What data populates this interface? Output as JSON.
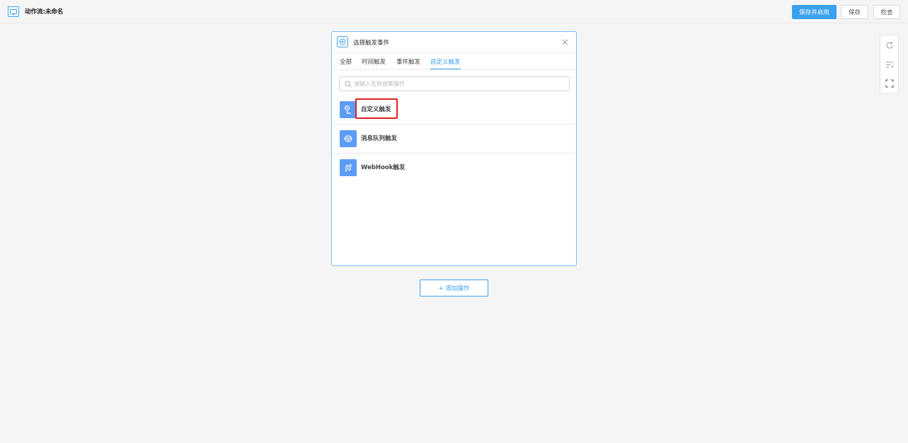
{
  "header": {
    "title": "动作流:未命名",
    "primary_button": "保存并启用",
    "save_button": "保存",
    "check_button": "检查"
  },
  "toolbar": {
    "tools": [
      "refresh-icon",
      "sort-icon",
      "fit-view-icon"
    ]
  },
  "dialog": {
    "title": "选择触发事件",
    "tabs": [
      {
        "label": "全部",
        "active": false
      },
      {
        "label": "时间触发",
        "active": false
      },
      {
        "label": "事件触发",
        "active": false
      },
      {
        "label": "自定义触发",
        "active": true
      }
    ],
    "search": {
      "placeholder": "请输入名称搜索操作",
      "value": ""
    },
    "items": [
      {
        "label": "自定义触发",
        "icon": "custom-trigger-icon",
        "highlighted": true
      },
      {
        "label": "消息队列触发",
        "icon": "message-queue-icon",
        "highlighted": false
      },
      {
        "label": "WebHook触发",
        "icon": "webhook-icon",
        "highlighted": false
      }
    ]
  },
  "add_action": {
    "label": "+ 添加操作"
  },
  "colors": {
    "accent": "#3aa0f0",
    "item_icon_bg": "#5b9cf6",
    "highlight": "#e02020",
    "background": "#f5f5f6"
  }
}
